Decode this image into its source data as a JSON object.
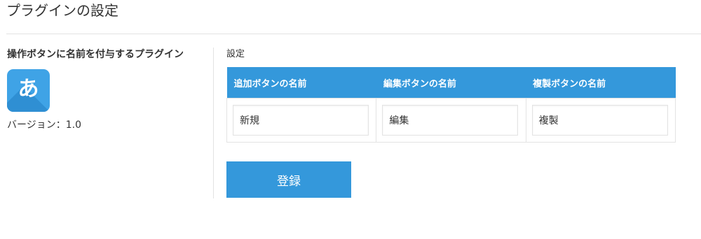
{
  "page": {
    "title": "プラグインの設定"
  },
  "plugin": {
    "name": "操作ボタンに名前を付与するプラグイン",
    "icon_glyph": "あ",
    "icon_color": "#3fa3e6",
    "version": "バージョン：1.0"
  },
  "settings": {
    "label": "設定",
    "header_color": "#3498db",
    "columns": [
      {
        "header": "追加ボタンの名前",
        "value": "新規"
      },
      {
        "header": "編集ボタンの名前",
        "value": "編集"
      },
      {
        "header": "複製ボタンの名前",
        "value": "複製"
      }
    ],
    "save_label": "登録"
  }
}
